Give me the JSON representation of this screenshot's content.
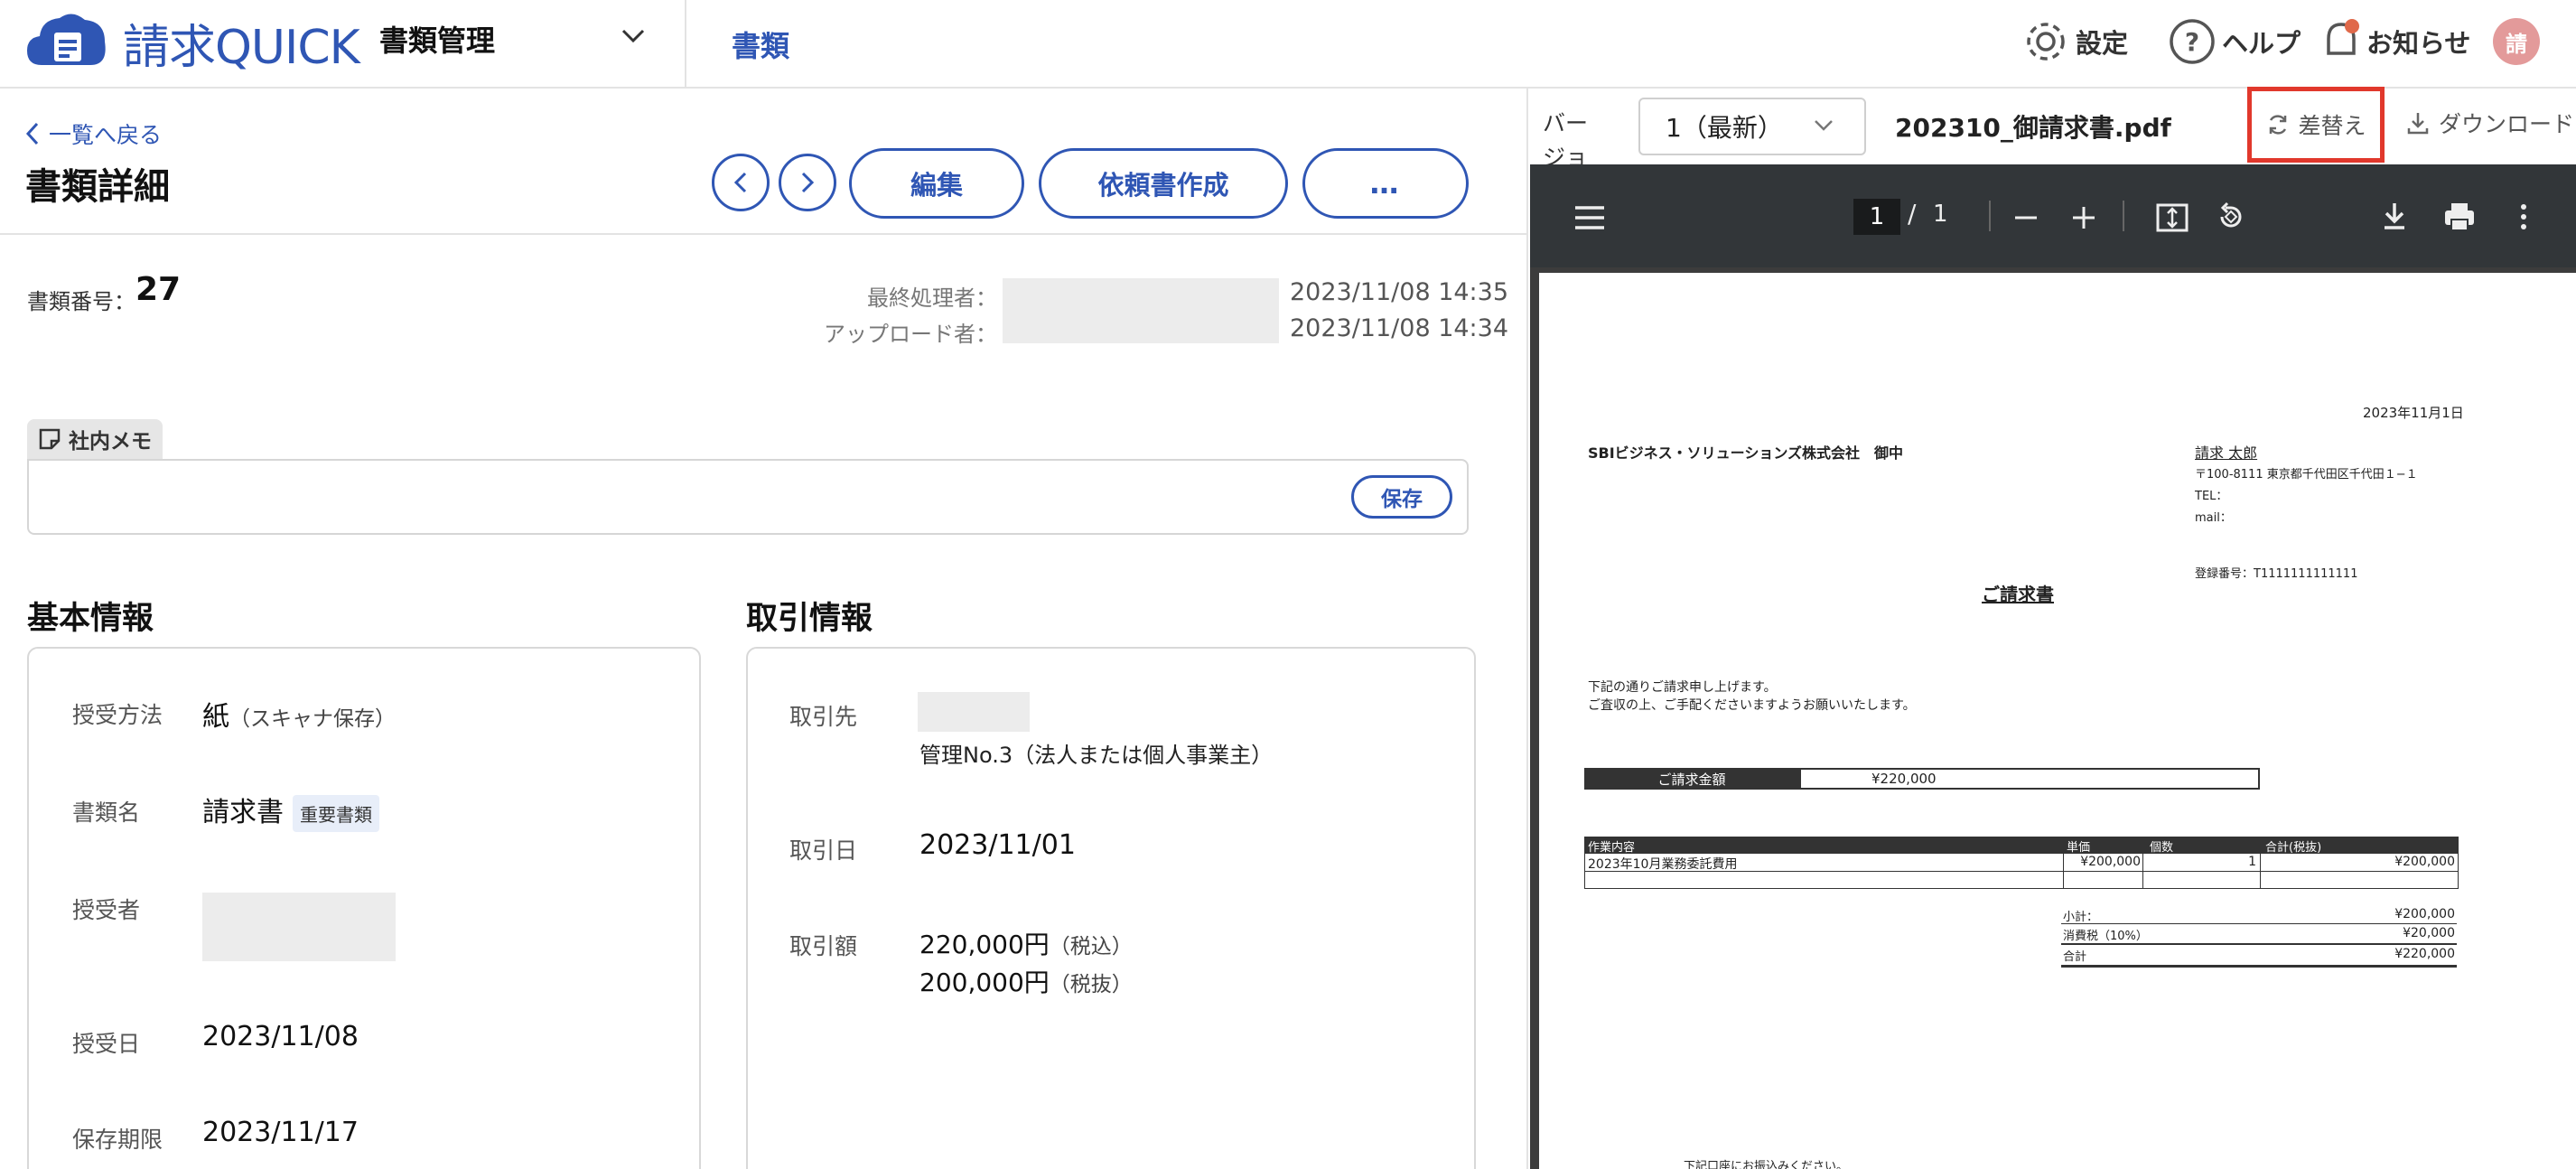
{
  "header": {
    "logo_text": "請求QUICK",
    "module": "書類管理",
    "nav_docs": "書類",
    "settings": "設定",
    "help": "ヘルプ",
    "notifications": "お知らせ",
    "avatar": "請"
  },
  "detail": {
    "back": "一覧へ戻る",
    "title": "書類詳細",
    "edit": "編集",
    "request": "依頼書作成",
    "more": "…",
    "docnum_label": "書類番号：",
    "docnum": "27",
    "last_processor_label": "最終処理者：",
    "last_processor_time": "2023/11/08 14:35",
    "uploader_label": "アップロード者：",
    "uploader_time": "2023/11/08 14:34",
    "memo_label": "社内メモ",
    "memo_save": "保存"
  },
  "basic": {
    "title": "基本情報",
    "rows": [
      {
        "label": "授受方法",
        "value": "紙",
        "note": "（スキャナ保存）"
      },
      {
        "label": "書類名",
        "value": "請求書",
        "badge": "重要書類"
      },
      {
        "label": "授受者",
        "value": ""
      },
      {
        "label": "授受日",
        "value": "2023/11/08"
      },
      {
        "label": "保存期限",
        "value": "2023/11/17"
      }
    ]
  },
  "transaction": {
    "title": "取引情報",
    "partner_label": "取引先",
    "partner_sub": "管理No.3（法人または個人事業主）",
    "date_label": "取引日",
    "date": "2023/11/01",
    "amount_label": "取引額",
    "amount_incl": "220,000円",
    "amount_incl_note": "（税込）",
    "amount_excl": "200,000円",
    "amount_excl_note": "（税抜）"
  },
  "preview": {
    "version_label": "バージョン",
    "version": "1（最新）",
    "filename": "202310_御請求書.pdf",
    "replace": "差替え",
    "download": "ダウンロード",
    "page_current": "1",
    "page_sep": "/",
    "page_total": "1"
  },
  "invoice": {
    "date": "2023年11月1日",
    "recipient": "SBIビジネス・ソリューションズ株式会社　御中",
    "sender_name": "請求 太郎",
    "sender_address": "〒100-8111 東京都千代田区千代田１−１",
    "sender_tel": "TEL：",
    "sender_mail": "mail：",
    "reg_no": "登録番号：T1111111111111",
    "title": "ご請求書",
    "intro1": "下記の通りご請求申し上げます。",
    "intro2": "ご査収の上、ご手配くださいますようお願いいたします。",
    "amount_label": "ご請求金額",
    "amount": "¥220,000",
    "columns": [
      "作業内容",
      "単価",
      "個数",
      "合計(税抜)"
    ],
    "item": {
      "desc": "2023年10月業務委託費用",
      "price": "¥200,000",
      "qty": "1",
      "total": "¥200,000"
    },
    "subtotal_label": "小計：",
    "subtotal": "¥200,000",
    "tax_label": "消費税（10%）",
    "tax": "¥20,000",
    "total_label": "合計",
    "total": "¥220,000",
    "footer": "下記口座にお振込みください。"
  },
  "colors": {
    "accent": "#2f56b4",
    "highlight": "#e1382c",
    "pdf_toolbar": "#323639"
  }
}
